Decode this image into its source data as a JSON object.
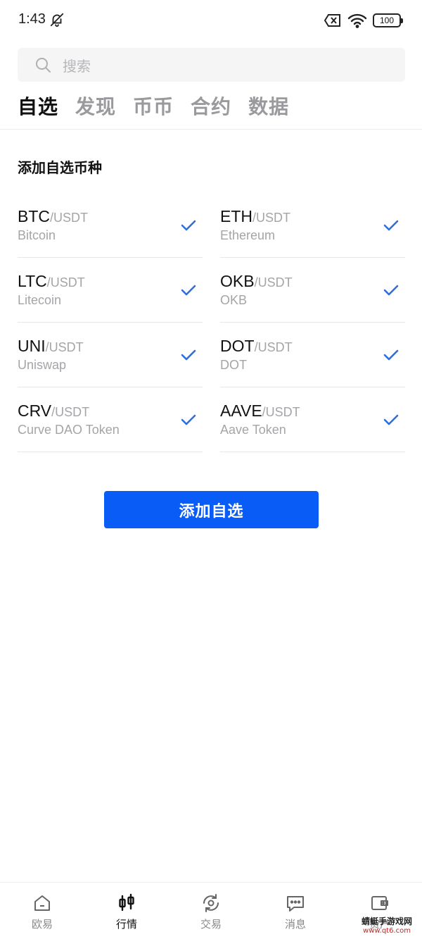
{
  "status_bar": {
    "time": "1:43",
    "battery": "100"
  },
  "search": {
    "placeholder": "搜索"
  },
  "tabs": [
    {
      "label": "自选",
      "active": true
    },
    {
      "label": "发现",
      "active": false
    },
    {
      "label": "币币",
      "active": false
    },
    {
      "label": "合约",
      "active": false
    },
    {
      "label": "数据",
      "active": false
    }
  ],
  "section_title": "添加自选币种",
  "coins": [
    {
      "symbol": "BTC",
      "pair": "/USDT",
      "name": "Bitcoin",
      "selected": true
    },
    {
      "symbol": "ETH",
      "pair": "/USDT",
      "name": "Ethereum",
      "selected": true
    },
    {
      "symbol": "LTC",
      "pair": "/USDT",
      "name": "Litecoin",
      "selected": true
    },
    {
      "symbol": "OKB",
      "pair": "/USDT",
      "name": "OKB",
      "selected": true
    },
    {
      "symbol": "UNI",
      "pair": "/USDT",
      "name": "Uniswap",
      "selected": true
    },
    {
      "symbol": "DOT",
      "pair": "/USDT",
      "name": "DOT",
      "selected": true
    },
    {
      "symbol": "CRV",
      "pair": "/USDT",
      "name": "Curve DAO Token",
      "selected": true
    },
    {
      "symbol": "AAVE",
      "pair": "/USDT",
      "name": "Aave Token",
      "selected": true
    }
  ],
  "add_button": {
    "label": "添加自选"
  },
  "bottom_nav": [
    {
      "label": "欧易",
      "icon": "home-icon",
      "active": false
    },
    {
      "label": "行情",
      "icon": "candlestick-icon",
      "active": true
    },
    {
      "label": "交易",
      "icon": "trade-icon",
      "active": false
    },
    {
      "label": "消息",
      "icon": "message-icon",
      "active": false
    },
    {
      "label": "资产",
      "icon": "wallet-icon",
      "active": false
    }
  ],
  "watermark": {
    "text": "蜻蜓手游戏网",
    "url": "www.qt6.com"
  },
  "colors": {
    "accent": "#0a5cf7",
    "check": "#2f6fdc",
    "muted": "#a5a5a9"
  }
}
